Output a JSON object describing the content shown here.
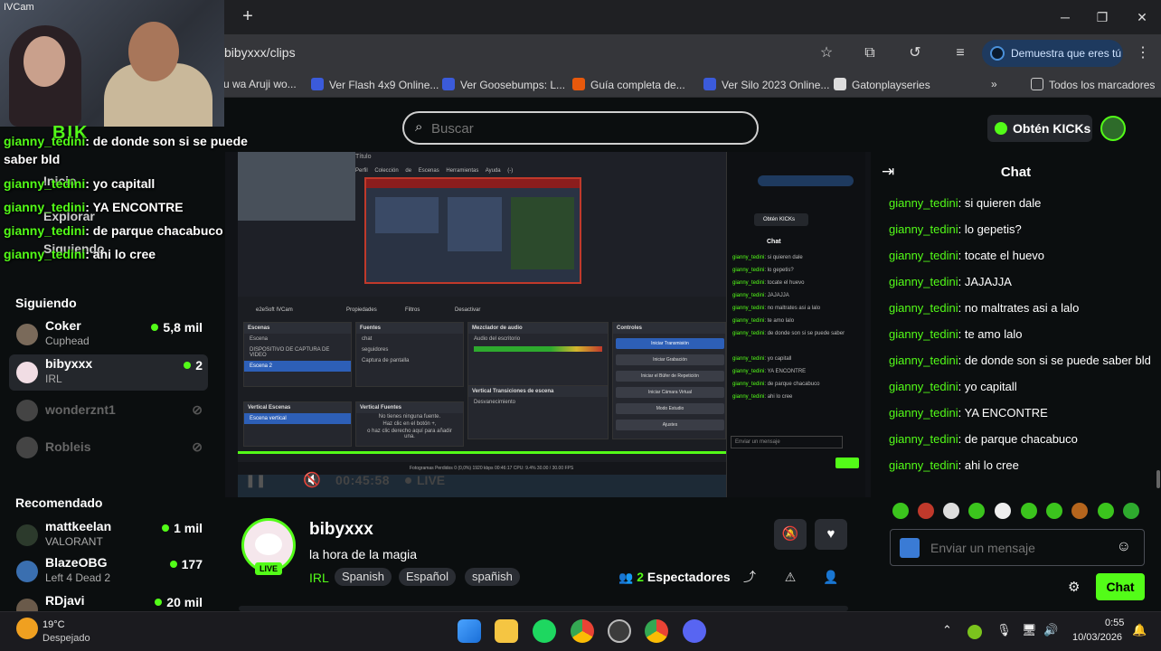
{
  "webcam": {
    "app_title": "IVCam",
    "overlay_word": "BIK"
  },
  "browser": {
    "url": "bibyxxx/clips",
    "profile_label": "Demuestra que eres tú",
    "bookmarks": [
      "u wa Aruji wo...",
      "Ver Flash 4x9 Online...",
      "Ver Goosebumps: L...",
      "Guía completa de...",
      "Ver Silo 2023 Online...",
      "Gatonplayseries",
      "»",
      "Todos los marcadores"
    ]
  },
  "overlay_chat": [
    {
      "user": "gianny_tedini",
      "text": ": de donde son si se puede saber bld"
    },
    {
      "user": "gianny_tedini",
      "text": ": yo capitall"
    },
    {
      "user": "gianny_tedini",
      "text": ": YA ENCONTRE"
    },
    {
      "user": "gianny_tedini",
      "text": ": de parque chacabuco"
    },
    {
      "user": "gianny_tedini",
      "text": ": ahi lo cree"
    }
  ],
  "ghost_nav": [
    "Inicio",
    "Explorar",
    "Siguiendo"
  ],
  "search": {
    "placeholder": "Buscar"
  },
  "header": {
    "kicks_label": "Obtén KICKs"
  },
  "sidebar": {
    "following_title": "Siguiendo",
    "following": [
      {
        "name": "Coker",
        "category": "Cuphead",
        "viewers": "5,8 mil"
      },
      {
        "name": "bibyxxx",
        "category": "IRL",
        "viewers": "2"
      },
      {
        "name": "wonderznt1",
        "category": "",
        "viewers": ""
      },
      {
        "name": "Robleis",
        "category": "",
        "viewers": ""
      }
    ],
    "recommended_title": "Recomendado",
    "recommended": [
      {
        "name": "mattkeelan",
        "category": "VALORANT",
        "viewers": "1 mil"
      },
      {
        "name": "BlazeOBG",
        "category": "Left 4 Dead 2",
        "viewers": "177"
      },
      {
        "name": "RDjavi",
        "category": "",
        "viewers": "20 mil"
      }
    ]
  },
  "video": {
    "obs_title": "Título",
    "obs_menu": "Perfil Colección de Escenas Herramientas Ayuda (-)",
    "obs_source_label": "e2eSoft IVCam",
    "obs_props": "Propiedades",
    "obs_filters": "Filtros",
    "obs_disable": "Desactivar",
    "panels": {
      "scenes": {
        "title": "Escenas",
        "items": [
          "Escena",
          "DISPOSITIVO DE CAPTURA DE VIDEO",
          "Escena 2"
        ]
      },
      "sources": {
        "title": "Fuentes",
        "items": [
          "chat",
          "seguidores",
          "Captura de pantalla"
        ]
      },
      "mixer": {
        "title": "Mezclador de audio",
        "items": [
          "Audio del escritorio"
        ]
      },
      "controls": {
        "title": "Controles",
        "buttons": [
          "Iniciar Transmisión",
          "Iniciar Grabación",
          "Iniciar el Búfer de Repetición",
          "Iniciar Cámara Virtual",
          "Modo Estudio",
          "Ajustes"
        ]
      },
      "vscenes": {
        "title": "Vertical Escenas",
        "items": [
          "Escena vertical"
        ]
      },
      "vsources": {
        "title": "Vertical Fuentes",
        "items": [
          "No tienes ninguna fuente.",
          "Haz clic en el botón +,",
          "o haz clic derecho aquí para añadir una."
        ]
      },
      "vtrans": {
        "title": "Vertical Transiciones de escena",
        "items": [
          "Desvanecimiento"
        ]
      }
    },
    "obs_status": "Fotogramas Perdidos 0 (0,0%)   1920 kbps   00:46:17   CPU: 9.4%   30.00 / 30.00 FPS",
    "obs_chat_title": "Chat",
    "obs_kicks": "Obtén KICKs",
    "obs_chat_lines": [
      {
        "u": "gianny_tedini",
        "t": ": si quieren dale"
      },
      {
        "u": "gianny_tedini",
        "t": ": lo gepetis?"
      },
      {
        "u": "gianny_tedini",
        "t": ": tocate el huevo"
      },
      {
        "u": "gianny_tedini",
        "t": ": JAJAJJA"
      },
      {
        "u": "gianny_tedini",
        "t": ": no maltrates asi a lalo"
      },
      {
        "u": "gianny_tedini",
        "t": ": te amo lalo"
      },
      {
        "u": "gianny_tedini",
        "t": ": de donde son si se puede saber"
      },
      {
        "u": "gianny_tedini",
        "t": ": yo capitall"
      },
      {
        "u": "gianny_tedini",
        "t": ": YA ENCONTRE"
      },
      {
        "u": "gianny_tedini",
        "t": ": de parque chacabuco"
      },
      {
        "u": "gianny_tedini",
        "t": ": ahi lo cree"
      }
    ],
    "obs_chat_input": "Enviar un mensaje",
    "player_time": "00:45:58",
    "player_live": "LIVE"
  },
  "stream": {
    "streamer": "bibyxxx",
    "live_badge": "LIVE",
    "title": "la hora de la magia",
    "category": "IRL",
    "tags": [
      "Spanish",
      "Español",
      "spañish"
    ],
    "viewers_count": "2",
    "viewers_label": "Espectadores"
  },
  "chat": {
    "title": "Chat",
    "messages": [
      {
        "user": "gianny_tedini",
        "text": ": si quieren dale"
      },
      {
        "user": "gianny_tedini",
        "text": ": lo gepetis?"
      },
      {
        "user": "gianny_tedini",
        "text": ": tocate el huevo"
      },
      {
        "user": "gianny_tedini",
        "text": ": JAJAJJA"
      },
      {
        "user": "gianny_tedini",
        "text": ": no maltrates asi a lalo"
      },
      {
        "user": "gianny_tedini",
        "text": ": te amo lalo"
      },
      {
        "user": "gianny_tedini",
        "text": ": de donde son si se puede saber bld"
      },
      {
        "user": "gianny_tedini",
        "text": ": yo capitall"
      },
      {
        "user": "gianny_tedini",
        "text": ": YA ENCONTRE"
      },
      {
        "user": "gianny_tedini",
        "text": ": de parque chacabuco"
      },
      {
        "user": "gianny_tedini",
        "text": ": ahi lo cree"
      }
    ],
    "input_placeholder": "Enviar un mensaje",
    "send_label": "Chat"
  },
  "taskbar": {
    "temperature": "19°C",
    "weather": "Despejado",
    "time": "0:55",
    "date": "10/03/2026"
  }
}
